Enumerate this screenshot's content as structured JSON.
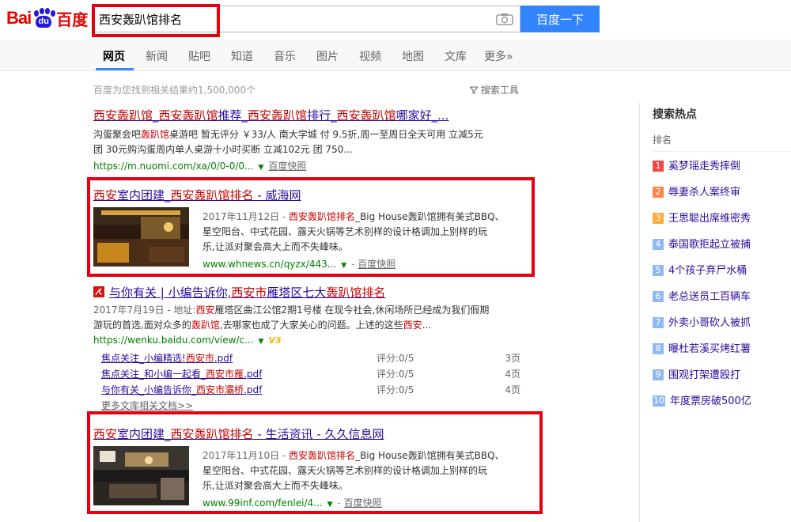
{
  "logo": {
    "bai": "Bai",
    "du": "du",
    "cn": "百度"
  },
  "search": {
    "query": "西安轰趴馆排名",
    "button": "百度一下"
  },
  "tabs": [
    "网页",
    "新闻",
    "贴吧",
    "知道",
    "音乐",
    "图片",
    "视频",
    "地图",
    "文库",
    "更多»"
  ],
  "result_count": "百度为您找到相关结果约1,500,000个",
  "search_tools": "搜索工具",
  "results": [
    {
      "title_parts": [
        "西安轰趴馆",
        "_",
        "西安轰趴馆",
        "推荐_",
        "西安轰趴馆",
        "排行_",
        "西安轰趴馆",
        "哪家好_..."
      ],
      "abstract_line1_a": "沟蛋聚会吧",
      "abstract_line1_hit": "轰趴馆",
      "abstract_line1_b": "桌游吧 暂无评分 ￥33/人 南大学城 付 9.5折,周一至周日全天可用 立减5元",
      "abstract_line2": "团 30元购沟蛋周内单人桌游十小时买断 立减102元 团 750...",
      "url": "https://m.nuomi.com/xa/0/0-0/0...",
      "snapshot": "百度快照"
    },
    {
      "title_a": "西安",
      "title_b": "室内团建_",
      "title_c": "西安轰趴馆排名",
      "title_d": " - 威海网",
      "date": "2017年11月12日 - ",
      "abstract_hit": "西安轰趴馆排名",
      "abstract_a": "_Big House轰趴馆拥有美式BBQ、",
      "abstract_line2": "星空阳台、中式花园、露天火锅等艺术别样的设计格调加上别样的玩",
      "abstract_line3": "乐,让派对聚会高大上而不失峰味。",
      "url": "www.whnews.cn/qyzx/443...",
      "snapshot": "百度快照"
    },
    {
      "title_a": "与你有关 | 小编告诉你,",
      "title_b": "西安市",
      "title_c": "雁塔区七大",
      "title_d": "轰趴馆排名",
      "date": "2017年7月19日 - 地址:",
      "addr_hit": "西安",
      "abstract_a": "雁塔区曲江公馆2期1号楼 在现今社会,休闲场所已经成为我们假期",
      "abstract_line2_a": "游玩的首选,面对众多的",
      "abstract_line2_hit": "轰趴馆",
      "abstract_line2_b": ",去哪家也成了大家关心的问题。上述的这些",
      "abstract_line2_hit2": "西安",
      "abstract_line2_c": "...",
      "url": "https://wenku.baidu.com/view/c...",
      "v3": "V3",
      "docs": [
        {
          "title_a": "焦点关注_小编精选!",
          "title_hit": "西安市",
          "title_b": ".pdf",
          "rate": "评分:0/5",
          "pages": "3页"
        },
        {
          "title_a": "焦点关注_和小编一起看_",
          "title_hit": "西安市雁",
          "title_b": ".pdf",
          "rate": "评分:0/5",
          "pages": "4页"
        },
        {
          "title_a": "与你有关_小编告诉你_",
          "title_hit": "西安市灞桥",
          "title_b": ".pdf",
          "rate": "评分:0/5",
          "pages": "4页"
        }
      ],
      "more_docs": "更多文库相关文档>>"
    },
    {
      "title_a": "西安",
      "title_b": "室内团建_",
      "title_c": "西安轰趴馆排名",
      "title_d": " - 生活资讯 - 久久信息网",
      "date": "2017年11月10日 - ",
      "abstract_hit": "西安轰趴馆排名",
      "abstract_a": "_Big House轰趴馆拥有美式BBQ、",
      "abstract_line2": "星空阳台、中式花园、露天火锅等艺术别样的设计格调加上别样的玩",
      "abstract_line3": "乐,让派对聚会高大上而不失峰味。",
      "url": "www.99inf.com/fenlei/4...",
      "snapshot": "百度快照"
    }
  ],
  "sidebar": {
    "title": "搜索热点",
    "header": "排名",
    "items": [
      {
        "rank": "1",
        "text": "奚梦瑶走秀摔倒",
        "color": "#f54545"
      },
      {
        "rank": "2",
        "text": "辱妻杀人案终审",
        "color": "#ff8547"
      },
      {
        "rank": "3",
        "text": "王思聪出席维密秀",
        "color": "#ffac38"
      },
      {
        "rank": "4",
        "text": "泰国歌拒起立被捕",
        "color": "#8eb9f5"
      },
      {
        "rank": "5",
        "text": "4个孩子弃尸水桶",
        "color": "#8eb9f5"
      },
      {
        "rank": "6",
        "text": "老总送员工百辆车",
        "color": "#8eb9f5"
      },
      {
        "rank": "7",
        "text": "外卖小哥砍人被抓",
        "color": "#8eb9f5"
      },
      {
        "rank": "8",
        "text": "曝杜若溪买烤红薯",
        "color": "#8eb9f5"
      },
      {
        "rank": "9",
        "text": "围观打架遭殴打",
        "color": "#8eb9f5"
      },
      {
        "rank": "10",
        "text": "年度票房破500亿",
        "color": "#8eb9f5"
      }
    ]
  },
  "colors": {
    "brand_red": "#e10601",
    "brand_blue": "#2319dc",
    "button_blue": "#3385ff",
    "highlight_box": "#e60012",
    "link": "#2b0a9e",
    "hit": "#cc0000",
    "url_green": "#008000"
  }
}
